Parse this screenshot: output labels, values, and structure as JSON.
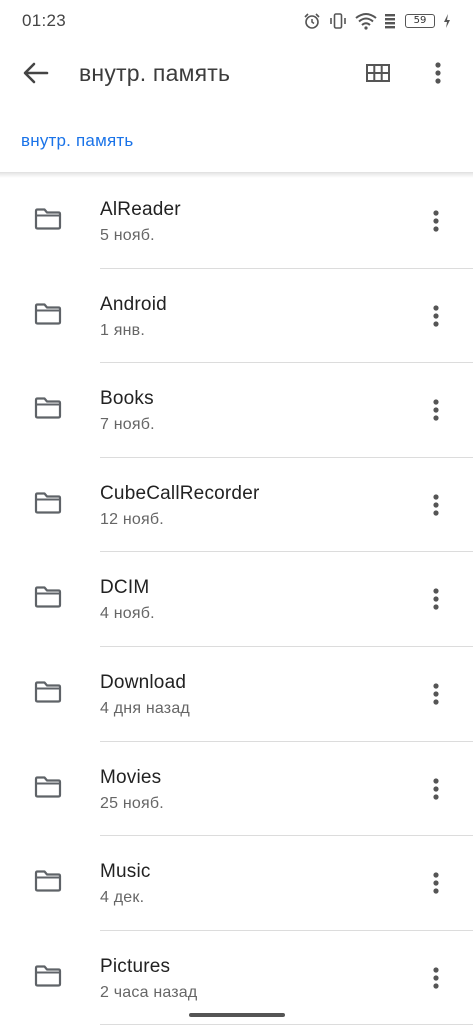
{
  "status_bar": {
    "time": "01:23",
    "battery_level": "59",
    "icons": [
      "alarm-icon",
      "vibrate-icon",
      "wifi-icon",
      "signal-icon",
      "battery-icon",
      "charging-icon"
    ]
  },
  "app_bar": {
    "title": "внутр. память",
    "back_icon": "arrow-back-icon",
    "grid_icon": "grid-view-icon",
    "more_icon": "more-vert-icon"
  },
  "breadcrumb": {
    "path": "внутр. память"
  },
  "colors": {
    "accent": "#1a73e8",
    "text_primary": "#222222",
    "text_secondary": "#666666",
    "icon": "#5f6368"
  },
  "folders": [
    {
      "name": "AlReader",
      "date": "5 нояб."
    },
    {
      "name": "Android",
      "date": "1 янв."
    },
    {
      "name": "Books",
      "date": "7 нояб."
    },
    {
      "name": "CubeCallRecorder",
      "date": "12 нояб."
    },
    {
      "name": "DCIM",
      "date": "4 нояб."
    },
    {
      "name": "Download",
      "date": "4 дня назад"
    },
    {
      "name": "Movies",
      "date": "25 нояб."
    },
    {
      "name": "Music",
      "date": "4 дек."
    },
    {
      "name": "Pictures",
      "date": "2 часа назад"
    }
  ]
}
